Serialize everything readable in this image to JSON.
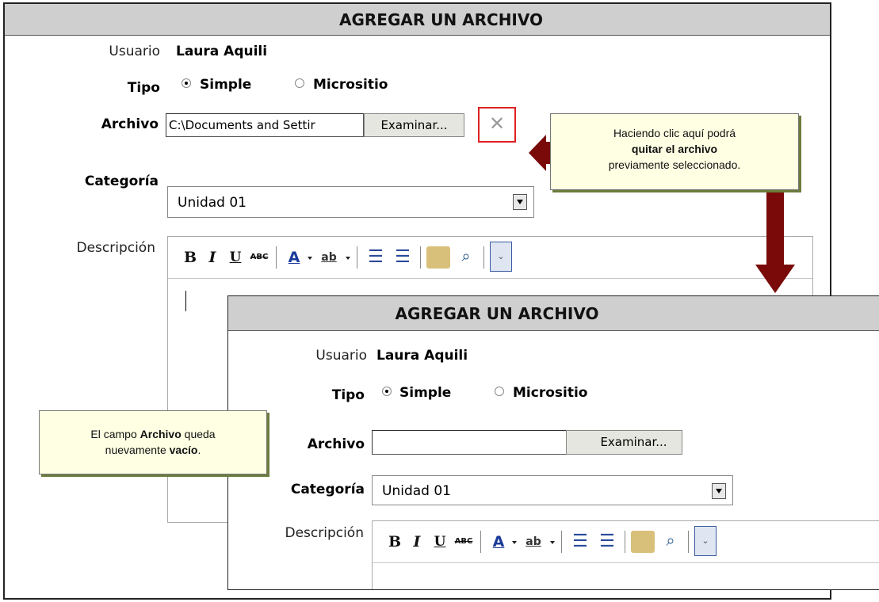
{
  "back_panel": {
    "title": "AGREGAR UN ARCHIVO",
    "usuario_label": "Usuario",
    "usuario_value": "Laura Aquili",
    "tipo_label": "Tipo",
    "tipo_options": [
      "Simple",
      "Micrositio"
    ],
    "tipo_selected": "Simple",
    "archivo_label": "Archivo",
    "archivo_value": "C:\\Documents and Settir",
    "examinar_label": "Examinar...",
    "remove_icon": "close-icon",
    "categoria_label": "Categoría",
    "categoria_value": "Unidad 01",
    "descripcion_label": "Descripción"
  },
  "front_panel": {
    "title": "AGREGAR UN ARCHIVO",
    "usuario_label": "Usuario",
    "usuario_value": "Laura Aquili",
    "tipo_label": "Tipo",
    "tipo_options": [
      "Simple",
      "Micrositio"
    ],
    "tipo_selected": "Simple",
    "archivo_label": "Archivo",
    "archivo_value": "",
    "examinar_label": "Examinar...",
    "categoria_label": "Categoría",
    "categoria_value": "Unidad 01",
    "descripcion_label": "Descripción"
  },
  "toolbar": {
    "bold": "B",
    "italic": "I",
    "underline": "U",
    "strike": "ABC",
    "font_color": "A",
    "highlight": "ab",
    "icons": [
      "bold-icon",
      "italic-icon",
      "underline-icon",
      "strikethrough-icon",
      "font-color-icon",
      "highlight-icon",
      "bulleted-list-icon",
      "numbered-list-icon",
      "paste-from-word-icon",
      "find-icon",
      "expand-toolbar-icon"
    ]
  },
  "callout_top": {
    "line1": "Haciendo clic aquí podrá",
    "line2_bold": "quitar el archivo",
    "line3": "previamente seleccionado."
  },
  "callout_left": {
    "prefix": "El campo ",
    "bold1": "Archivo",
    "mid": " queda",
    "line2_start": "nuevamente ",
    "bold2": "vacío",
    "suffix": "."
  },
  "colors": {
    "header_bg": "#cfcfcf",
    "callout_bg": "#ffffe3",
    "arrow": "#7a0a0a",
    "highlight_box": "#e02020"
  }
}
